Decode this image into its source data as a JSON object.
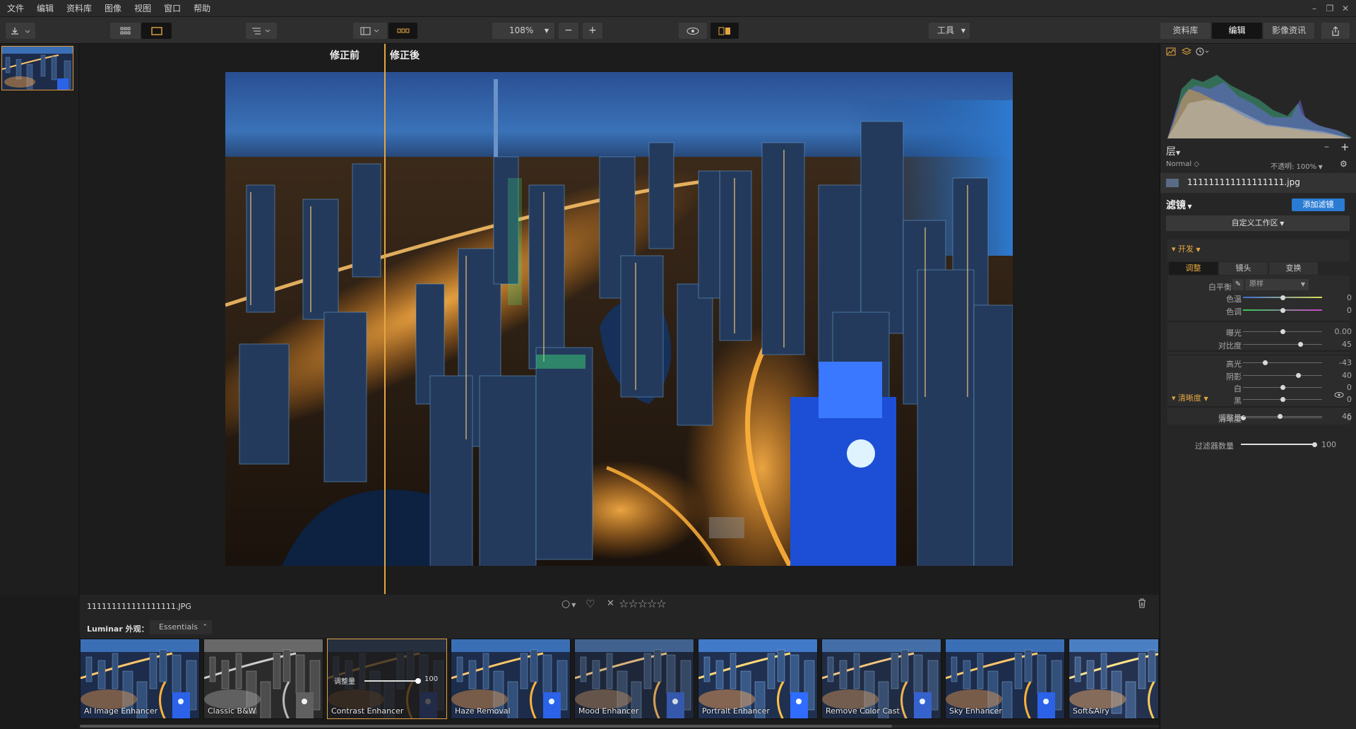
{
  "menu": {
    "items": [
      "文件",
      "编辑",
      "资料库",
      "图像",
      "视图",
      "窗口",
      "帮助"
    ]
  },
  "window_controls": {
    "minimize": "–",
    "restore": "❐",
    "close": "✕"
  },
  "toolbar": {
    "zoom": "108%",
    "zoom_minus": "−",
    "zoom_plus": "+",
    "tools_label": "工具",
    "tabs": [
      {
        "label": "资料库",
        "active": false
      },
      {
        "label": "编辑",
        "active": true
      },
      {
        "label": "影像资讯",
        "active": false
      }
    ]
  },
  "compare": {
    "before": "修正前",
    "after": "修正後"
  },
  "info": {
    "filename": "111111111111111111.JPG",
    "stars": [
      "☆",
      "☆",
      "☆",
      "☆",
      "☆"
    ],
    "reject": "✕",
    "flag": "○",
    "heart": "♡"
  },
  "looks": {
    "label": "Luminar 外观：",
    "selected": "Essentials"
  },
  "presets": [
    {
      "label": "AI Image Enhancer",
      "selected": false
    },
    {
      "label": "Classic B&W",
      "selected": false
    },
    {
      "label": "Contrast Enhancer",
      "selected": true,
      "amount_label": "调整量",
      "amount": "100"
    },
    {
      "label": "Haze Removal",
      "selected": false
    },
    {
      "label": "Mood Enhancer",
      "selected": false
    },
    {
      "label": "Portrait Enhancer",
      "selected": false
    },
    {
      "label": "Remove Color Cast",
      "selected": false
    },
    {
      "label": "Sky Enhancer",
      "selected": false
    },
    {
      "label": "Soft&Airy",
      "selected": false
    }
  ],
  "panel": {
    "layers_label": "层",
    "blend_mode": "Normal",
    "opacity_label": "不透明: 100%",
    "layer_name": "111111111111111111.jpg",
    "filters_label": "滤镜",
    "add_filter": "添加滤镜",
    "workspace": "自定义工作区",
    "develop": {
      "title": "开发",
      "tabs": [
        {
          "label": "调整",
          "active": true
        },
        {
          "label": "镜头",
          "active": false
        },
        {
          "label": "变换",
          "active": false
        }
      ],
      "wb_label": "白平衡",
      "wb_value": "原样",
      "sliders": [
        {
          "label": "色温",
          "value": "0",
          "pos": 0.5
        },
        {
          "label": "色调",
          "value": "0",
          "pos": 0.5
        },
        {
          "label": "曝光",
          "value": "0.00",
          "pos": 0.5
        },
        {
          "label": "对比度",
          "value": "45",
          "pos": 0.72
        },
        {
          "label": "高光",
          "value": "-43",
          "pos": 0.28
        },
        {
          "label": "阴影",
          "value": "40",
          "pos": 0.7
        },
        {
          "label": "白",
          "value": "0",
          "pos": 0.5
        },
        {
          "label": "黑",
          "value": "0",
          "pos": 0.5
        },
        {
          "label": "清晰度",
          "value": "0",
          "pos": 0.0
        }
      ]
    },
    "clarity": {
      "title": "清晰度",
      "label": "调整量",
      "value": "46",
      "pos": 0.46
    },
    "filter_amount": {
      "label": "过滤器数量",
      "value": "100",
      "pos": 1.0
    }
  },
  "colors": {
    "accent": "#e5a642",
    "blue_button": "#2a7bd4",
    "selected_tab": "#141414"
  }
}
